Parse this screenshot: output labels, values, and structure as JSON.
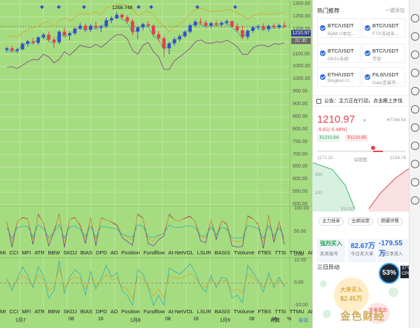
{
  "price_axis": [
    "1300.00",
    "1250.00",
    "1200.00",
    "1150.00",
    "1100.00",
    "1050.00",
    "1000.00",
    "950.00",
    "900.00",
    "850.00",
    "800.00",
    "750.00",
    "700.00",
    "650.00",
    "600.00",
    "550.00",
    "500.00"
  ],
  "current_price_tag": "1210.97",
  "countdown_tag": "31:30",
  "high_marker": "1268.748",
  "osc_axis": [
    "100.00",
    "50.00",
    "0.00"
  ],
  "osc2_axis": [
    "10.00",
    "0.00",
    "-10.00"
  ],
  "indicators": [
    "MI",
    "CCI",
    "MFI",
    "ATR",
    "BBW",
    "SKDJ",
    "BIAS",
    "DPD",
    "AD",
    "Position",
    "Fundflow",
    "AI-NetVOL",
    "LSUR",
    "BASIS",
    "TVolume",
    "FTBS",
    "TTSI",
    "TTMU",
    "AI-BSI"
  ],
  "dates": [
    "1月7",
    "08",
    "16",
    "1月8",
    "08",
    "16",
    "1月9",
    "08",
    "16"
  ],
  "toggle_label": "对数",
  "percent_label": "%",
  "auto_label": "自动",
  "right_panel": {
    "hot_title": "热门推荐",
    "hot_more": "一键添加",
    "cards": [
      {
        "sym": "BTC/USDT",
        "ex": "Bybit U本位..."
      },
      {
        "sym": "BTC/USDT",
        "ex": "FTX活动永..."
      },
      {
        "sym": "BTC/USDT",
        "ex": "OKEx永续"
      },
      {
        "sym": "BTC/USDT",
        "ex": "币安"
      },
      {
        "sym": "ETH/USDT",
        "ex": "Bingbon U..."
      },
      {
        "sym": "FIL6/USDT",
        "ex": "Gate芝麻开..."
      }
    ],
    "notice": "公告：主力正在行动，点击跟上步伐",
    "price": "1210.97",
    "price_arrow": "▾",
    "mini_right": "¥7786.54",
    "change": "-5.61(-0.48%)",
    "chip_bid": "₮1210.84",
    "chip_ask": "₮1210.85",
    "depth_left": "1171.32",
    "depth_mid": "深度图",
    "depth_right": "1234.78",
    "depth_y_top": "400",
    "depth_y_bottom": "200",
    "depth_x": "₮1210",
    "btn_main": "主力挂单",
    "btn_all": "全網深度",
    "btn_fuel": "燃爆评餐",
    "stat1_val": "82.67万",
    "stat1_lbl": "今日买大单",
    "stat2_val": "-179.55万",
    "stat2_lbl": "今日净流入",
    "stat0_val": "强烈买入",
    "stat0_lbl": "买卖指号",
    "sec_title": "三日异动",
    "big_buy": "大单买入",
    "big_buy_amt": "$2.45万",
    "big_sell": "大单卖出",
    "gauge_val": "53%",
    "temp_val": "37°C",
    "temp_lbl": "CPU温度",
    "watermark": "金色财经"
  },
  "colors": {
    "chart_bg": "#a6dc80",
    "up_candle": "#3550c8",
    "down_candle": "#e0424a",
    "price_tag": "#333f8f",
    "countdown_tag": "#6e6e6e",
    "accent_red": "#e5434d",
    "accent_blue": "#2d6ad8"
  },
  "chart_data": {
    "type": "candlestick",
    "ylim": [
      500,
      1300
    ],
    "candles": [
      [
        1118,
        1130,
        1108,
        1124
      ],
      [
        1124,
        1134,
        1110,
        1114
      ],
      [
        1114,
        1126,
        1104,
        1120
      ],
      [
        1120,
        1148,
        1116,
        1142
      ],
      [
        1142,
        1158,
        1130,
        1152
      ],
      [
        1152,
        1166,
        1140,
        1146
      ],
      [
        1146,
        1172,
        1138,
        1168
      ],
      [
        1168,
        1186,
        1160,
        1178
      ],
      [
        1178,
        1190,
        1150,
        1158
      ],
      [
        1158,
        1170,
        1126,
        1148
      ],
      [
        1148,
        1196,
        1140,
        1190
      ],
      [
        1190,
        1206,
        1170,
        1176
      ],
      [
        1176,
        1192,
        1156,
        1184
      ],
      [
        1184,
        1208,
        1176,
        1202
      ],
      [
        1202,
        1224,
        1196,
        1214
      ],
      [
        1214,
        1222,
        1190,
        1198
      ],
      [
        1198,
        1220,
        1188,
        1214
      ],
      [
        1214,
        1230,
        1200,
        1206
      ],
      [
        1206,
        1218,
        1188,
        1212
      ],
      [
        1212,
        1246,
        1204,
        1236
      ],
      [
        1236,
        1252,
        1224,
        1244
      ],
      [
        1244,
        1269,
        1238,
        1258
      ],
      [
        1258,
        1264,
        1238,
        1248
      ],
      [
        1248,
        1256,
        1222,
        1232
      ],
      [
        1232,
        1242,
        1176,
        1190
      ],
      [
        1190,
        1214,
        1160,
        1208
      ],
      [
        1208,
        1226,
        1196,
        1220
      ],
      [
        1220,
        1232,
        1208,
        1214
      ],
      [
        1214,
        1220,
        1170,
        1180
      ],
      [
        1180,
        1192,
        1150,
        1164
      ],
      [
        1164,
        1172,
        1090,
        1124
      ],
      [
        1124,
        1150,
        1100,
        1144
      ],
      [
        1144,
        1168,
        1134,
        1160
      ],
      [
        1160,
        1180,
        1150,
        1172
      ],
      [
        1172,
        1196,
        1166,
        1190
      ],
      [
        1190,
        1222,
        1184,
        1216
      ],
      [
        1216,
        1238,
        1210,
        1230
      ],
      [
        1230,
        1244,
        1218,
        1226
      ],
      [
        1226,
        1236,
        1206,
        1214
      ],
      [
        1214,
        1230,
        1204,
        1224
      ],
      [
        1224,
        1234,
        1210,
        1218
      ],
      [
        1218,
        1232,
        1208,
        1226
      ],
      [
        1226,
        1240,
        1216,
        1232
      ],
      [
        1232,
        1236,
        1206,
        1212
      ],
      [
        1212,
        1224,
        1190,
        1196
      ],
      [
        1196,
        1214,
        1160,
        1170
      ],
      [
        1170,
        1200,
        1160,
        1194
      ],
      [
        1194,
        1214,
        1186,
        1208
      ],
      [
        1208,
        1220,
        1196,
        1212
      ],
      [
        1212,
        1224,
        1196,
        1200
      ],
      [
        1200,
        1218,
        1190,
        1214
      ],
      [
        1214,
        1224,
        1202,
        1208
      ],
      [
        1208,
        1222,
        1200,
        1216
      ],
      [
        1216,
        1228,
        1206,
        1211
      ]
    ]
  }
}
